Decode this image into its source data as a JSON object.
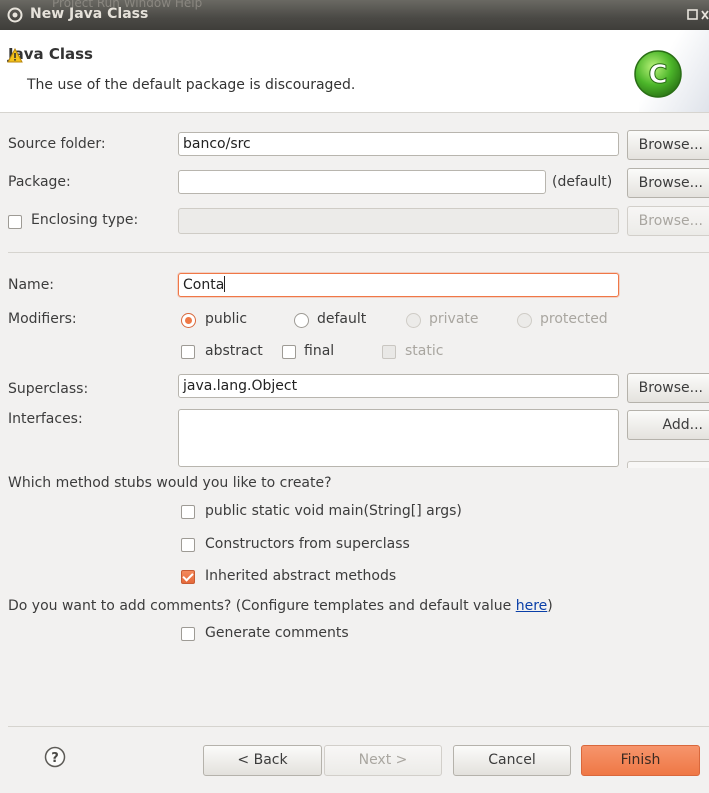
{
  "window": {
    "title": "New Java Class",
    "background_menu": "Project  Run  Window  Help"
  },
  "header": {
    "title": "Java Class",
    "message": "The use of the default package is discouraged.",
    "icons": {
      "warning": "warning-icon",
      "logo": "java-class-logo-icon"
    }
  },
  "form": {
    "source_folder": {
      "label": "Source folder:",
      "value": "banco/src",
      "button": "Browse..."
    },
    "package": {
      "label": "Package:",
      "value": "",
      "default_hint": "(default)",
      "button": "Browse..."
    },
    "enclosing_type": {
      "label": "Enclosing type:",
      "value": "",
      "checked": false,
      "button": "Browse..."
    },
    "name": {
      "label": "Name:",
      "value": "Conta"
    },
    "modifiers": {
      "label": "Modifiers:",
      "public": "public",
      "default": "default",
      "private": "private",
      "protected": "protected",
      "selected": "public",
      "abstract": "abstract",
      "final": "final",
      "static": "static"
    },
    "superclass": {
      "label": "Superclass:",
      "value": "java.lang.Object",
      "button": "Browse..."
    },
    "interfaces": {
      "label": "Interfaces:",
      "button": "Add..."
    }
  },
  "stubs": {
    "question": "Which method stubs would you like to create?",
    "main": {
      "label": "public static void main(String[] args)",
      "checked": false
    },
    "constructors": {
      "label": "Constructors from superclass",
      "checked": false
    },
    "inherited": {
      "label": "Inherited abstract methods",
      "checked": true
    }
  },
  "comments": {
    "question": "Do you want to add comments? (Configure templates and default value ",
    "link": "here",
    "close_paren": ")",
    "generate": {
      "label": "Generate comments",
      "checked": false
    }
  },
  "footer": {
    "back": "< Back",
    "next": "Next >",
    "cancel": "Cancel",
    "finish": "Finish"
  },
  "colors": {
    "accent": "#ef7845",
    "focus_border": "#f07746",
    "titlebar": "#4a4945",
    "link": "#0a3fa8"
  }
}
